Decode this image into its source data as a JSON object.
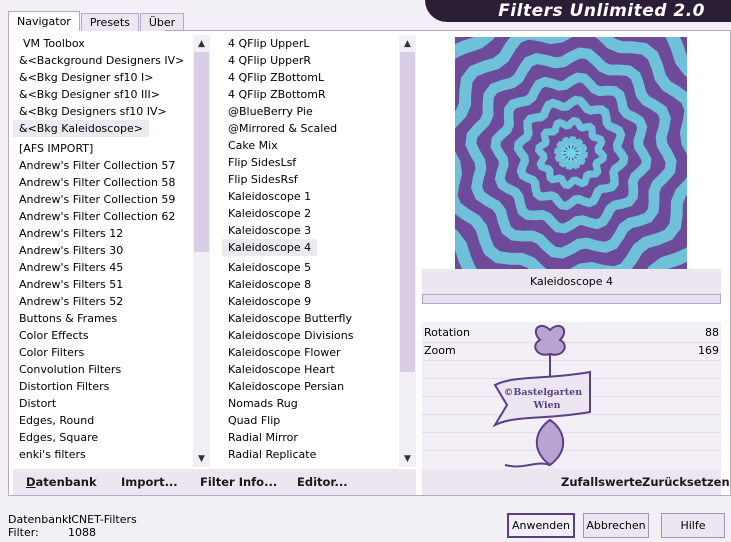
{
  "tabs": [
    "Navigator",
    "Presets",
    "Über"
  ],
  "banner_title": "Filters Unlimited 2.0",
  "categories": [
    "VM Toolbox",
    "&<Background Designers IV>",
    "&<Bkg Designer sf10 I>",
    "&<Bkg Designer sf10 III>",
    "&<Bkg Designers sf10 IV>",
    "&<Bkg Kaleidoscope>",
    "[AFS IMPORT]",
    "Andrew's Filter Collection 57",
    "Andrew's Filter Collection 58",
    "Andrew's Filter Collection 59",
    "Andrew's Filter Collection 62",
    "Andrew's Filters 12",
    "Andrew's Filters 30",
    "Andrew's Filters 45",
    "Andrew's Filters 51",
    "Andrew's Filters 52",
    "Buttons & Frames",
    "Color Effects",
    "Color Filters",
    "Convolution Filters",
    "Distortion Filters",
    "Distort",
    "Edges, Round",
    "Edges, Square",
    "enki's filters"
  ],
  "filters": [
    "4 QFlip UpperL",
    "4 QFlip UpperR",
    "4 QFlip ZBottomL",
    "4 QFlip ZBottomR",
    "@BlueBerry Pie",
    "@Mirrored & Scaled",
    "Cake Mix",
    "Flip SidesLsf",
    "Flip SidesRsf",
    "Kaleidoscope 1",
    "Kaleidoscope 2",
    "Kaleidoscope 3",
    "Kaleidoscope 4",
    "Kaleidoscope 5",
    "Kaleidoscope 8",
    "Kaleidoscope 9",
    "Kaleidoscope Butterfly",
    "Kaleidoscope Divisions",
    "Kaleidoscope Flower",
    "Kaleidoscope Heart",
    "Kaleidoscope Persian",
    "Nomads Rug",
    "Quad Flip",
    "Radial Mirror",
    "Radial Replicate"
  ],
  "toolbar": {
    "datenbank": "Datenbank",
    "import": "Import...",
    "filter_info": "Filter Info...",
    "editor": "Editor..."
  },
  "selected_filter_name": "Kaleidoscope 4",
  "params": [
    {
      "name": "Rotation",
      "value": "88"
    },
    {
      "name": "Zoom",
      "value": "169"
    }
  ],
  "right_toolbar": {
    "zufallswerte": "Zufallswerte",
    "zuruecksetzen": "Zurücksetzen"
  },
  "watermark_text": [
    "©Bastelgarten",
    "Wien"
  ],
  "footer": {
    "datenbank_label": "Datenbank:",
    "datenbank_value": "ICNET-Filters",
    "filter_label": "Filter:",
    "filter_value": "1088"
  },
  "buttons": {
    "apply": "Anwenden",
    "cancel": "Abbrechen",
    "help": "Hilfe"
  },
  "colors": {
    "accent": "#5d3f84",
    "banner_bg": "#2b1d36",
    "preview_purple": "#6e4a9a",
    "preview_cyan": "#6fd6e4"
  },
  "icons": {
    "scroll_up": "▲",
    "scroll_down": "▼"
  }
}
